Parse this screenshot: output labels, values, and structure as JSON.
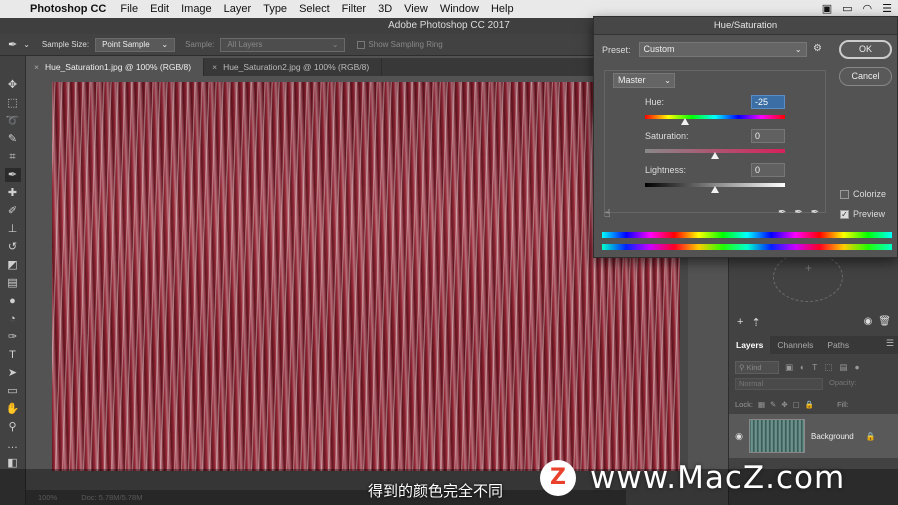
{
  "menubar": {
    "app": "Photoshop CC",
    "items": [
      "File",
      "Edit",
      "Image",
      "Layer",
      "Type",
      "Select",
      "Filter",
      "3D",
      "View",
      "Window",
      "Help"
    ]
  },
  "titlebar": {
    "title": "Adobe Photoshop CC 2017"
  },
  "options": {
    "sample_size_label": "Sample Size:",
    "sample_size_value": "Point Sample",
    "sample_label": "Sample:",
    "sample_value": "All Layers",
    "show_ring": "Show Sampling Ring"
  },
  "tabs": [
    {
      "label": "Hue_Saturation1.jpg @ 100% (RGB/8)"
    },
    {
      "label": "Hue_Saturation2.jpg @ 100% (RGB/8)"
    }
  ],
  "statusbar": {
    "zoom": "100%",
    "doc": "Doc: 5.78M/5.78M"
  },
  "dialog": {
    "title": "Hue/Saturation",
    "preset_label": "Preset:",
    "preset_value": "Custom",
    "ok": "OK",
    "cancel": "Cancel",
    "channel": "Master",
    "hue_label": "Hue:",
    "hue_value": "-25",
    "sat_label": "Saturation:",
    "sat_value": "0",
    "light_label": "Lightness:",
    "light_value": "0",
    "colorize": "Colorize",
    "preview": "Preview"
  },
  "layers": {
    "tabs": [
      "Layers",
      "Channels",
      "Paths"
    ],
    "kind": "Kind",
    "blend": "Normal",
    "opacity_label": "Opacity:",
    "lock_label": "Lock:",
    "fill_label": "Fill:",
    "layer_name": "Background"
  },
  "overlay": {
    "subtitle": "得到的颜色完全不同",
    "watermark": "www.MacZ.com",
    "logo_letter": "Z"
  }
}
